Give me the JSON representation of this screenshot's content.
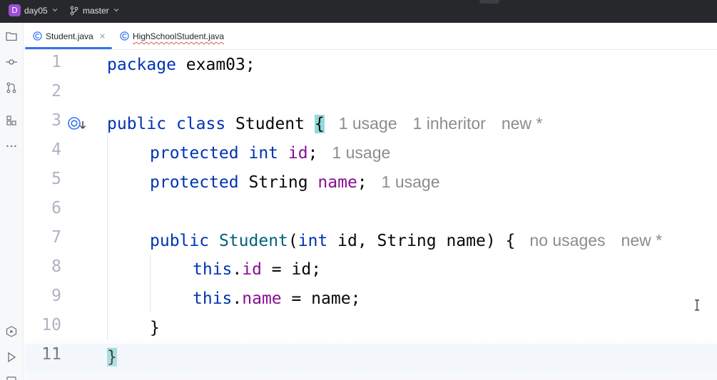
{
  "titlebar": {
    "project_badge": "D",
    "project_name": "day05",
    "branch_name": "master"
  },
  "tabs": [
    {
      "label": "Student.java",
      "active": true,
      "close": "×"
    },
    {
      "label": "HighSchoolStudent.java",
      "active": false
    }
  ],
  "editor": {
    "line_numbers": [
      "1",
      "2",
      "3",
      "4",
      "5",
      "6",
      "7",
      "8",
      "9",
      "10",
      "11"
    ],
    "current_line": 11,
    "lines": {
      "l1": {
        "kw": "package",
        "rest": " exam03;"
      },
      "l3": {
        "kw1": "public",
        "kw2": "class",
        "name": " Student ",
        "brace": "{",
        "hint1": "1 usage",
        "hint2": "1 inheritor",
        "hint3": "new *"
      },
      "l4": {
        "kw1": "protected",
        "kw2": "int",
        "field": "id",
        "semi": ";",
        "hint": "1 usage"
      },
      "l5": {
        "kw1": "protected",
        "type": " String ",
        "field": "name",
        "semi": ";",
        "hint": "1 usage"
      },
      "l7": {
        "kw": "public",
        "fn": "Student",
        "p_open": "(",
        "p_kw": "int",
        "params": " id, String name) {",
        "hint1": "no usages",
        "hint2": "new *"
      },
      "l8": {
        "kw": "this",
        "dot": ".",
        "field": "id",
        "rest": " = id;"
      },
      "l9": {
        "kw": "this",
        "dot": ".",
        "field": "name",
        "rest": " = name;"
      },
      "l10": {
        "text": "}"
      },
      "l11": {
        "text": "}"
      }
    }
  },
  "icons": {
    "toolstrip": [
      "folder-icon",
      "commit-icon",
      "pull-requests-icon",
      "structure-icon",
      "more-icon",
      "run-icon",
      "debug-icon"
    ],
    "tab_file": "java-class-icon",
    "gutter": "overridden-method-icon"
  },
  "colors": {
    "keyword": "#0033b3",
    "field": "#871094",
    "method": "#00627a",
    "hint": "#8c8c8c",
    "brace_match": "#93d9d9",
    "tab_accent": "#3574f0",
    "titlebar": "#27282c"
  }
}
